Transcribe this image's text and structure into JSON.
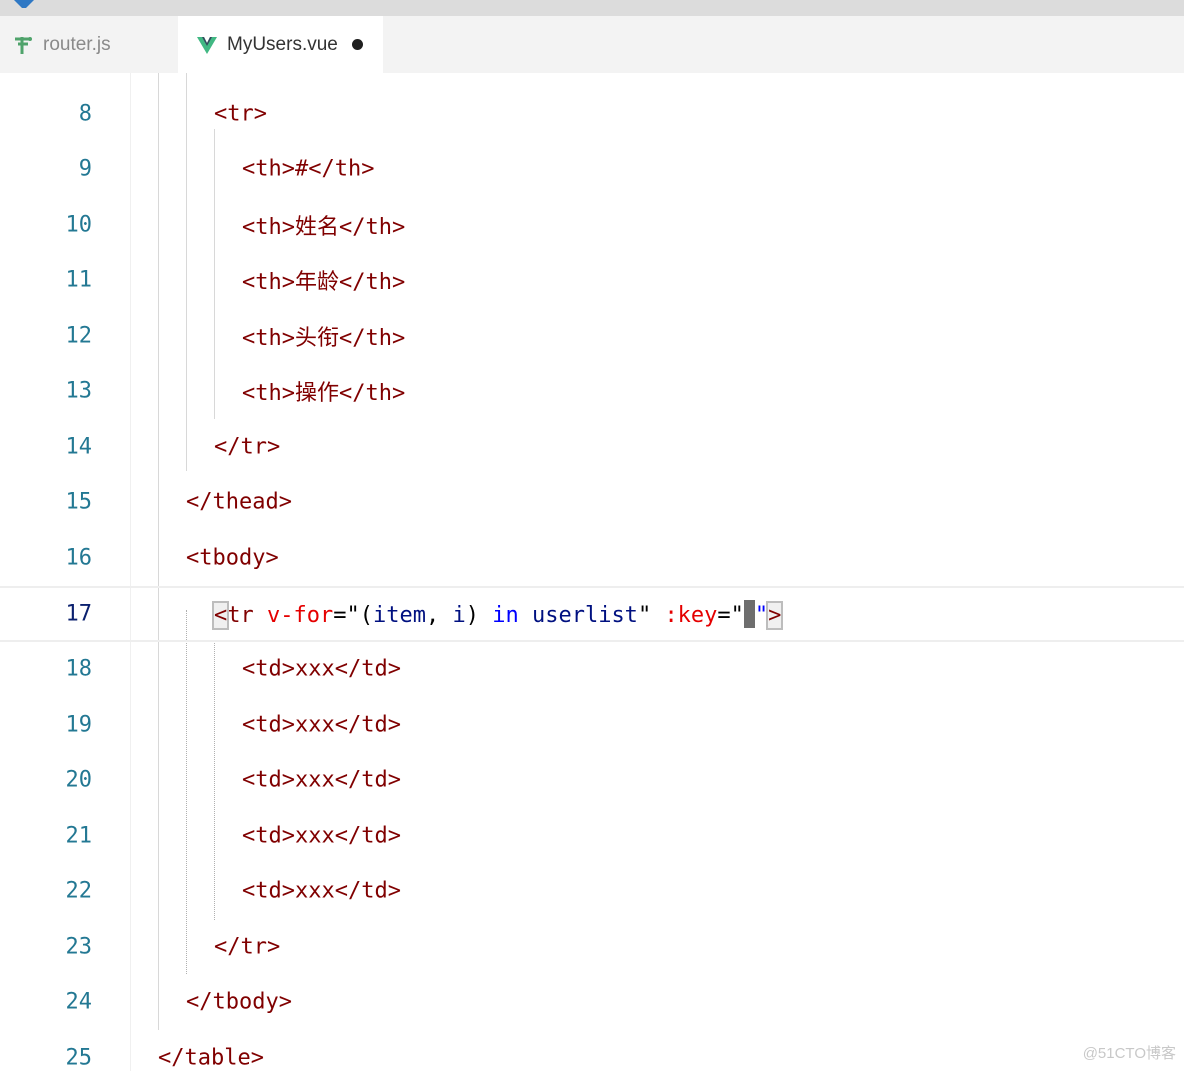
{
  "colors": {
    "tag": "#800000",
    "attribute": "#e50000",
    "string": "#0000ff",
    "keyword": "#0000ff",
    "variable": "#001080",
    "line_number": "#237893",
    "line_number_active": "#0b216f"
  },
  "tabs": [
    {
      "label": "router.js",
      "icon": "router-file-icon",
      "active": false
    },
    {
      "label": "MyUsers.vue",
      "icon": "vue-file-icon",
      "active": true,
      "dirty": true
    }
  ],
  "editor": {
    "current_line": "17",
    "lines": [
      {
        "num": "8",
        "code": "<tr>"
      },
      {
        "num": "9",
        "code": "<th>#</th>"
      },
      {
        "num": "10",
        "code": "<th>姓名</th>"
      },
      {
        "num": "11",
        "code": "<th>年龄</th>"
      },
      {
        "num": "12",
        "code": "<th>头衔</th>"
      },
      {
        "num": "13",
        "code": "<th>操作</th>"
      },
      {
        "num": "14",
        "code": "</tr>"
      },
      {
        "num": "15",
        "code": "</thead>"
      },
      {
        "num": "16",
        "code": "<tbody>"
      },
      {
        "num": "17",
        "code": "<tr v-for=\"(item, i) in userlist\" :key=\"\">",
        "tokens": {
          "lt": "<",
          "tag": "tr",
          "attr1": "v-for",
          "eq1": "=\"(",
          "var1": "item",
          "comma": ", ",
          "var2": "i",
          "close": ") ",
          "kw": "in",
          "sp": " ",
          "var3": "userlist",
          "q": "\" ",
          "attr2": ":key",
          "eq2": "=\"",
          "q2": "\"",
          "gt": ">"
        }
      },
      {
        "num": "18",
        "code": "<td>xxx</td>"
      },
      {
        "num": "19",
        "code": "<td>xxx</td>"
      },
      {
        "num": "20",
        "code": "<td>xxx</td>"
      },
      {
        "num": "21",
        "code": "<td>xxx</td>"
      },
      {
        "num": "22",
        "code": "<td>xxx</td>"
      },
      {
        "num": "23",
        "code": "</tr>"
      },
      {
        "num": "24",
        "code": "</tbody>"
      },
      {
        "num": "25",
        "code": "</table>"
      }
    ]
  },
  "watermark": "@51CTO博客"
}
